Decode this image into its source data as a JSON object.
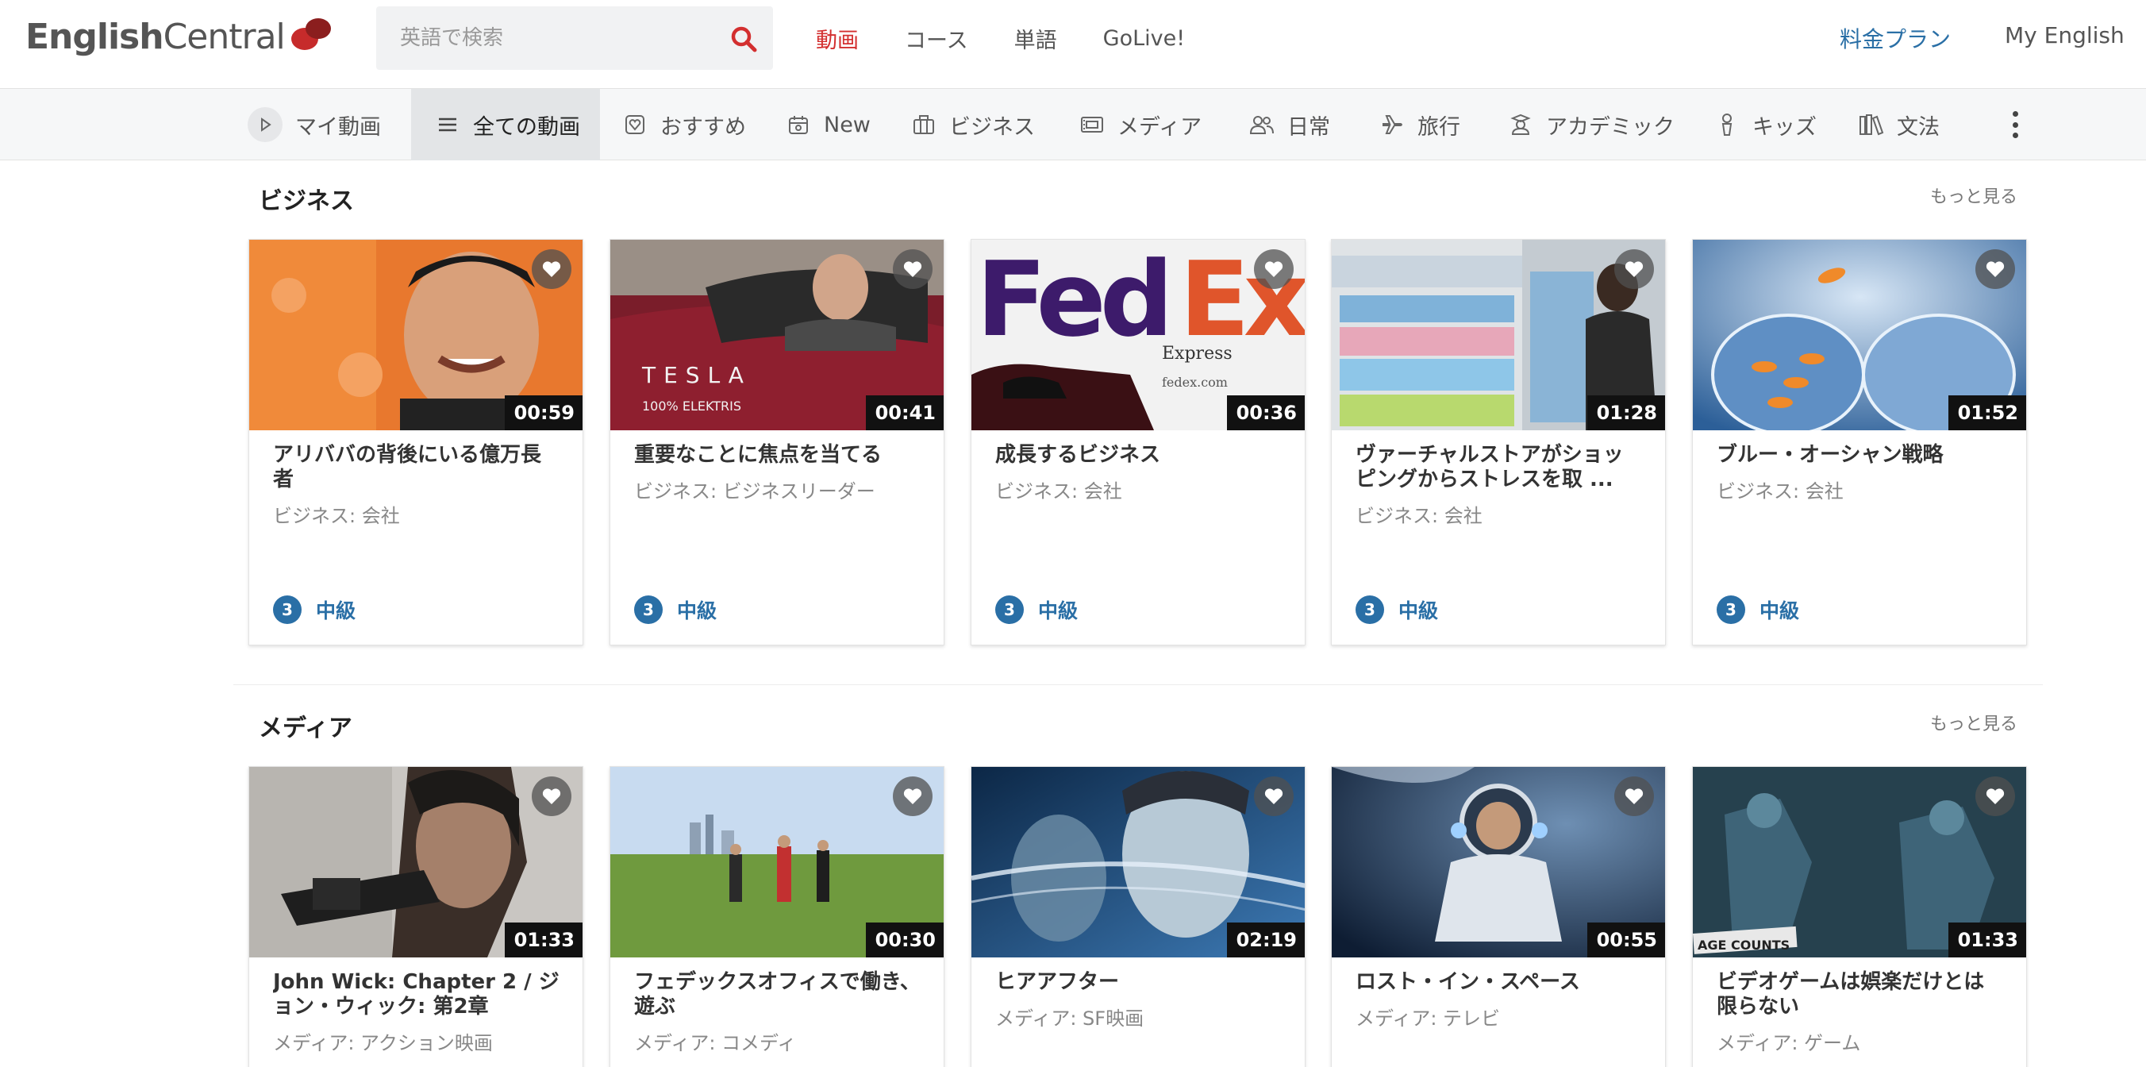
{
  "header": {
    "logo_text_bold": "English",
    "logo_text": "Central",
    "search_placeholder": "英語で検索",
    "nav": [
      "動画",
      "コース",
      "単語",
      "GoLive!"
    ],
    "pricing": "料金プラン",
    "my_english": "My English",
    "accent_color": "#d32f2f",
    "link_color": "#2a6fa6"
  },
  "categories": [
    {
      "label": "マイ動画",
      "icon": "play-icon"
    },
    {
      "label": "全ての動画",
      "icon": "list-icon",
      "active": true
    },
    {
      "label": "おすすめ",
      "icon": "heart-box-icon"
    },
    {
      "label": "New",
      "icon": "calendar-icon"
    },
    {
      "label": "ビジネス",
      "icon": "briefcase-icon"
    },
    {
      "label": "メディア",
      "icon": "film-icon"
    },
    {
      "label": "日常",
      "icon": "people-icon"
    },
    {
      "label": "旅行",
      "icon": "airplane-icon"
    },
    {
      "label": "アカデミック",
      "icon": "graduate-icon"
    },
    {
      "label": "キッズ",
      "icon": "kids-icon"
    },
    {
      "label": "文法",
      "icon": "books-icon"
    }
  ],
  "sections": [
    {
      "title": "ビジネス",
      "more": "もっと見る",
      "videos": [
        {
          "title": "アリババの背後にいる億万長者",
          "subtitle": "ビジネス: 会社",
          "duration": "00:59",
          "level_num": "3",
          "level": "中級",
          "thumb": "orange-portrait"
        },
        {
          "title": "重要なことに焦点を当てる",
          "subtitle": "ビジネス: ビジネスリーダー",
          "duration": "00:41",
          "level_num": "3",
          "level": "中級",
          "thumb": "red-car"
        },
        {
          "title": "成長するビジネス",
          "subtitle": "ビジネス: 会社",
          "duration": "00:36",
          "level_num": "3",
          "level": "中級",
          "thumb": "fedex-truck"
        },
        {
          "title": "ヴァーチャルストアがショッピングからストレスを取 ...",
          "subtitle": "ビジネス: 会社",
          "duration": "01:28",
          "level_num": "3",
          "level": "中級",
          "thumb": "store-shelves"
        },
        {
          "title": "ブルー・オーシャン戦略",
          "subtitle": "ビジネス: 会社",
          "duration": "01:52",
          "level_num": "3",
          "level": "中級",
          "thumb": "fish-bowls"
        }
      ]
    },
    {
      "title": "メディア",
      "more": "もっと見る",
      "videos": [
        {
          "title": "John Wick: Chapter 2 / ジョン・ウィック: 第2章",
          "subtitle": "メディア: アクション映画",
          "duration": "01:33",
          "thumb": "action-gun"
        },
        {
          "title": "フェデックスオフィスで働き、遊ぶ",
          "subtitle": "メディア: コメディ",
          "duration": "00:30",
          "thumb": "golf-field"
        },
        {
          "title": "ヒアアフター",
          "subtitle": "メディア: SF映画",
          "duration": "02:19",
          "thumb": "blue-faces"
        },
        {
          "title": "ロスト・イン・スペース",
          "subtitle": "メディア: テレビ",
          "duration": "00:55",
          "thumb": "astronaut"
        },
        {
          "title": "ビデオゲームは娯楽だけとは限らない",
          "subtitle": "メディア: ゲーム",
          "duration": "01:33",
          "thumb": "game-soldiers"
        }
      ]
    }
  ]
}
